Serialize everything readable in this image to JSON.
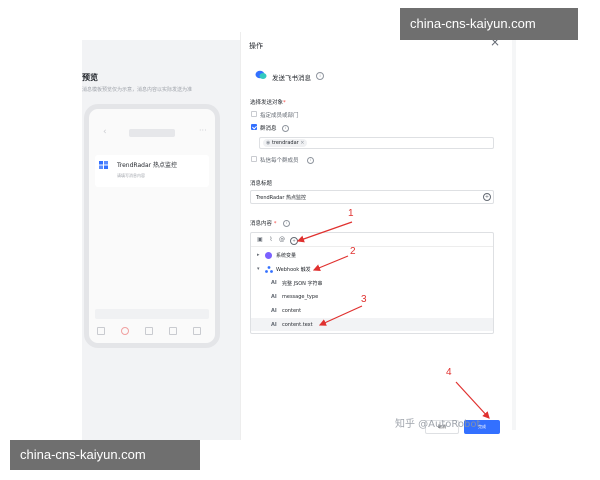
{
  "watermarks": {
    "top": "china-cns-kaiyun.com",
    "bottom": "china-cns-kaiyun.com"
  },
  "preview": {
    "title": "预览",
    "description": "消息模板预览仅为示意，消息内容以实际发送为准",
    "message_card": {
      "title": "TrendRadar 热点监控",
      "content": "请填写消息内容"
    }
  },
  "panel": {
    "title": "操作",
    "action_name": "发送飞书消息",
    "recipient_label": "选择发送对象",
    "options": [
      {
        "label": "指定成员或部门",
        "checked": false
      },
      {
        "label": "群消息",
        "checked": true
      },
      {
        "label": "私信每个群成员",
        "checked": false
      }
    ],
    "group_tag": "trendradar",
    "title_label": "消息标题",
    "title_value": "TrendRadar 热点监控",
    "content_label": "消息内容",
    "tree": {
      "system_vars": "系统变量",
      "webhook": "Webhook 触发",
      "fields": [
        "完整 JSON 字符串",
        "message_type",
        "content",
        "content.text"
      ],
      "field_icon": "AI"
    },
    "cancel_label": "取消",
    "submit_label": "完成"
  },
  "annotations": [
    "1",
    "2",
    "3",
    "4"
  ],
  "attribution": "知乎 @AutoRobot",
  "colors": {
    "accent": "#3370ff",
    "annotation": "#e0312f",
    "watermark_bg": "#6f6f6f"
  }
}
